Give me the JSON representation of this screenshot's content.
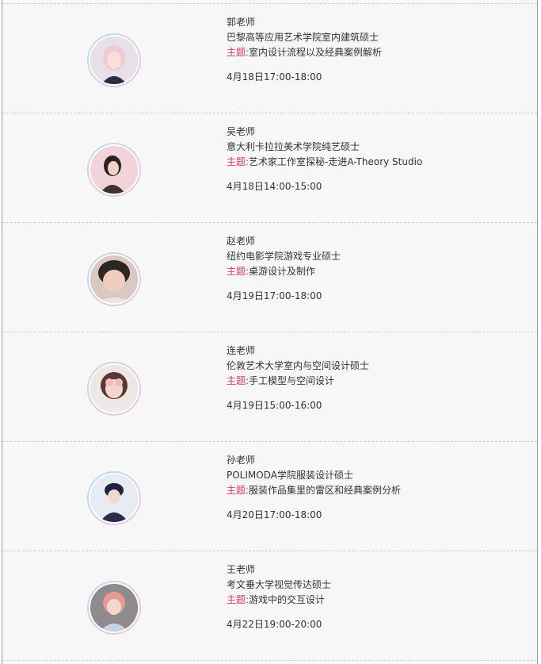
{
  "teachers": [
    {
      "name": "郭老师",
      "degree": "巴黎高等应用艺术学院室内建筑硕士",
      "topic_label": "主题:",
      "topic": "室内设计流程以及经典案例解析",
      "time": "4月18日17:00-18:00"
    },
    {
      "name": "吴老师",
      "degree": "意大利卡拉拉美术学院纯艺硕士",
      "topic_label": "主题:",
      "topic": "艺术家工作室探秘-走进A-Theory Studio",
      "time": "4月18日14:00-15:00"
    },
    {
      "name": "赵老师",
      "degree": "纽约电影学院游戏专业硕士",
      "topic_label": "主题:",
      "topic": "桌游设计及制作",
      "time": "4月19日17:00-18:00"
    },
    {
      "name": "连老师",
      "degree": "伦敦艺术大学室内与空间设计硕士",
      "topic_label": "主题:",
      "topic": "手工模型与空间设计",
      "time": "4月19日15:00-16:00"
    },
    {
      "name": "孙老师",
      "degree": "POLIMODA学院服装设计硕士",
      "topic_label": "主题:",
      "topic": "服装作品集里的雷区和经典案例分析",
      "time": "4月20日17:00-18:00"
    },
    {
      "name": "王老师",
      "degree": "考文垂大学视觉传达硕士",
      "topic_label": "主题:",
      "topic": "游戏中的交互设计",
      "time": "4月22日19:00-20:00"
    }
  ],
  "colors": {
    "accent": "#e0336f",
    "text": "#333333",
    "background": "#f7f7f7",
    "avatar_ring_start": "#b7dbf2",
    "avatar_ring_end": "#f3c6d8"
  }
}
